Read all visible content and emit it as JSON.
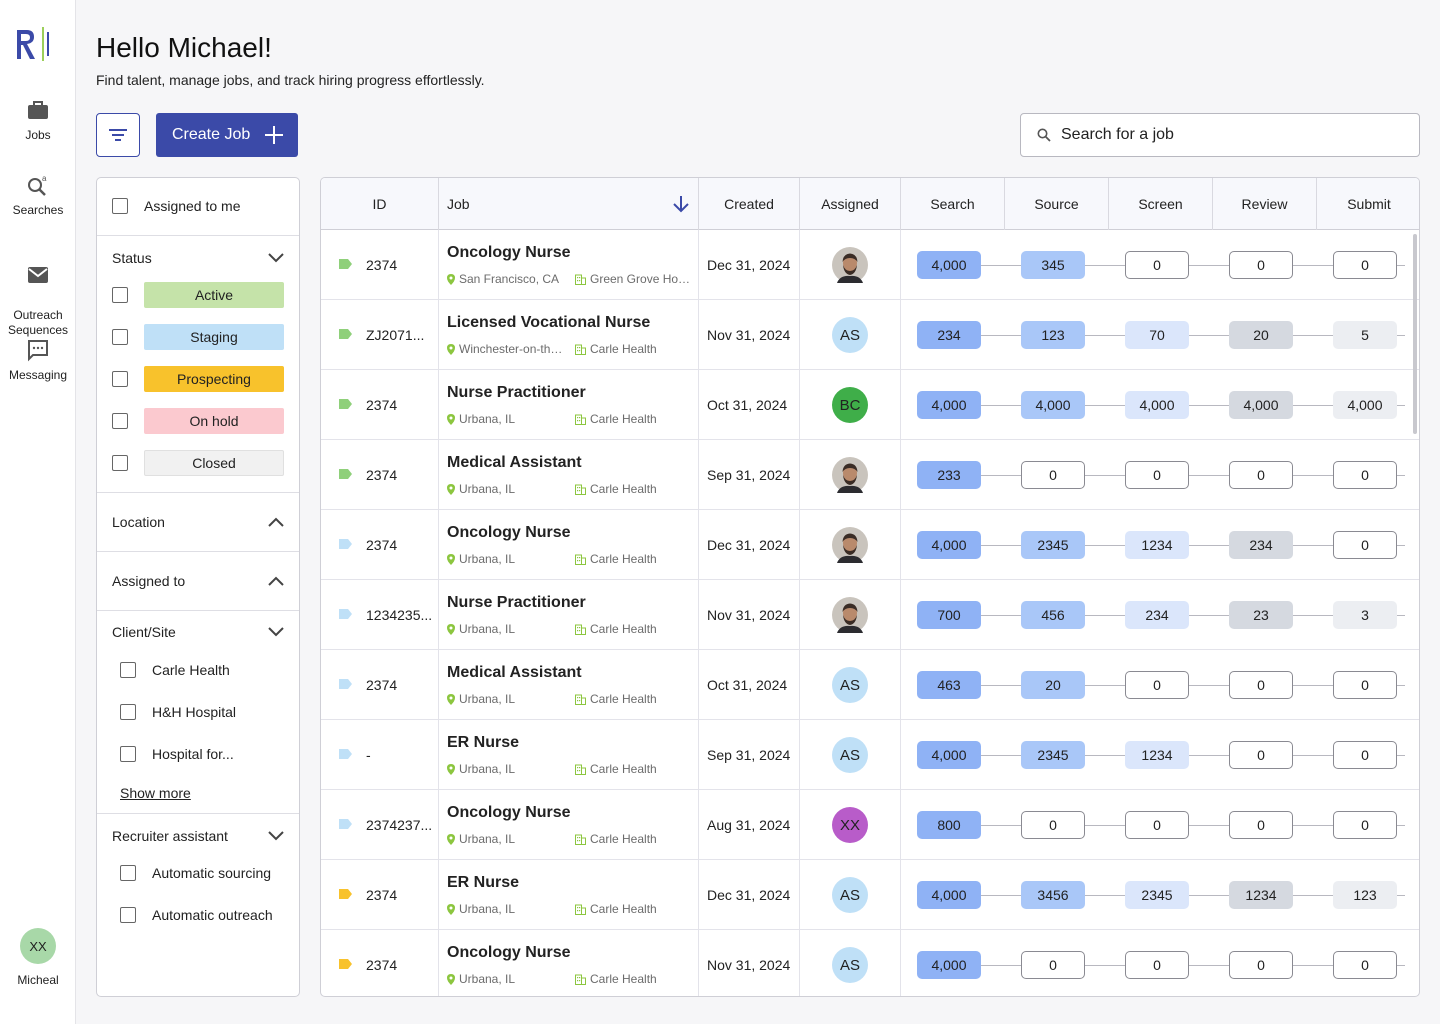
{
  "nav": {
    "items": [
      {
        "label": "Jobs",
        "icon": "briefcase-icon"
      },
      {
        "label": "Searches",
        "icon": "search-sparkle-icon"
      },
      {
        "label": "Outreach\nSequences",
        "icon": "mail-icon"
      },
      {
        "label": "Messaging",
        "icon": "chat-icon"
      }
    ],
    "user": {
      "initials": "XX",
      "name": "Micheal"
    }
  },
  "header": {
    "greeting": "Hello Michael!",
    "subtitle": "Find talent, manage jobs, and track hiring progress effortlessly.",
    "create_label": "Create Job",
    "search_placeholder": "Search for a job"
  },
  "filters": {
    "assigned_to_me": "Assigned to me",
    "status": {
      "title": "Status",
      "options": [
        {
          "label": "Active",
          "color": "#c5e3a9"
        },
        {
          "label": "Staging",
          "color": "#bfe0f7"
        },
        {
          "label": "Prospecting",
          "color": "#f8c22c"
        },
        {
          "label": "On hold",
          "color": "#fbc9cf"
        },
        {
          "label": "Closed",
          "color": "#f1f1f1"
        }
      ]
    },
    "location": {
      "title": "Location"
    },
    "assigned_to": {
      "title": "Assigned to"
    },
    "client_site": {
      "title": "Client/Site",
      "options": [
        "Carle Health",
        "H&H Hospital",
        "Hospital for..."
      ],
      "show_more": "Show more"
    },
    "recruiter_assistant": {
      "title": "Recruiter assistant",
      "options": [
        "Automatic sourcing",
        "Automatic outreach"
      ]
    }
  },
  "table": {
    "columns": [
      "ID",
      "Job",
      "Created",
      "Assigned",
      "Search",
      "Source",
      "Screen",
      "Review",
      "Submit"
    ],
    "rows": [
      {
        "id": "2374",
        "tag": "#8fd07a",
        "title": "Oncology Nurse",
        "location": "San Francisco, CA",
        "client": "Green Grove Hos...",
        "created": "Dec 31, 2024",
        "assigned": {
          "type": "photo"
        },
        "pipeline": [
          "4,000",
          "345",
          "0",
          "0",
          "0"
        ]
      },
      {
        "id": "ZJ2071...",
        "tag": "#8fd07a",
        "title": "Licensed Vocational Nurse",
        "location": "Winchester-on-the-...",
        "client": "Carle Health",
        "created": "Nov 31, 2024",
        "assigned": {
          "type": "initials",
          "text": "AS",
          "color": "#bfe0f7"
        },
        "pipeline": [
          "234",
          "123",
          "70",
          "20",
          "5"
        ]
      },
      {
        "id": "2374",
        "tag": "#8fd07a",
        "title": "Nurse Practitioner",
        "location": "Urbana, IL",
        "client": "Carle Health",
        "created": "Oct 31, 2024",
        "assigned": {
          "type": "initials",
          "text": "BC",
          "color": "#3fae49"
        },
        "pipeline": [
          "4,000",
          "4,000",
          "4,000",
          "4,000",
          "4,000"
        ]
      },
      {
        "id": "2374",
        "tag": "#8fd07a",
        "title": "Medical Assistant",
        "location": "Urbana, IL",
        "client": "Carle Health",
        "created": "Sep 31, 2024",
        "assigned": {
          "type": "photo"
        },
        "pipeline": [
          "233",
          "0",
          "0",
          "0",
          "0"
        ]
      },
      {
        "id": "2374",
        "tag": "#bfe0f7",
        "title": "Oncology Nurse",
        "location": "Urbana, IL",
        "client": "Carle Health",
        "created": "Dec 31, 2024",
        "assigned": {
          "type": "photo"
        },
        "pipeline": [
          "4,000",
          "2345",
          "1234",
          "234",
          "0"
        ]
      },
      {
        "id": "1234235...",
        "tag": "#bfe0f7",
        "title": "Nurse Practitioner",
        "location": "Urbana, IL",
        "client": "Carle Health",
        "created": "Nov 31, 2024",
        "assigned": {
          "type": "photo"
        },
        "pipeline": [
          "700",
          "456",
          "234",
          "23",
          "3"
        ]
      },
      {
        "id": "2374",
        "tag": "#bfe0f7",
        "title": "Medical Assistant",
        "location": "Urbana, IL",
        "client": "Carle Health",
        "created": "Oct 31, 2024",
        "assigned": {
          "type": "initials",
          "text": "AS",
          "color": "#bfe0f7"
        },
        "pipeline": [
          "463",
          "20",
          "0",
          "0",
          "0"
        ]
      },
      {
        "id": "-",
        "tag": "#bfe0f7",
        "title": "ER Nurse",
        "location": "Urbana, IL",
        "client": "Carle Health",
        "created": "Sep 31, 2024",
        "assigned": {
          "type": "initials",
          "text": "AS",
          "color": "#bfe0f7"
        },
        "pipeline": [
          "4,000",
          "2345",
          "1234",
          "0",
          "0"
        ]
      },
      {
        "id": "2374237...",
        "tag": "#bfe0f7",
        "title": "Oncology Nurse",
        "location": "Urbana, IL",
        "client": "Carle Health",
        "created": "Aug 31, 2024",
        "assigned": {
          "type": "initials",
          "text": "XX",
          "color": "#b85cc9"
        },
        "pipeline": [
          "800",
          "0",
          "0",
          "0",
          "0"
        ]
      },
      {
        "id": "2374",
        "tag": "#f8c22c",
        "title": "ER Nurse",
        "location": "Urbana, IL",
        "client": "Carle Health",
        "created": "Dec 31, 2024",
        "assigned": {
          "type": "initials",
          "text": "AS",
          "color": "#bfe0f7"
        },
        "pipeline": [
          "4,000",
          "3456",
          "2345",
          "1234",
          "123"
        ]
      },
      {
        "id": "2374",
        "tag": "#f8c22c",
        "title": "Oncology Nurse",
        "location": "Urbana, IL",
        "client": "Carle Health",
        "created": "Nov 31, 2024",
        "assigned": {
          "type": "initials",
          "text": "AS",
          "color": "#bfe0f7"
        },
        "pipeline": [
          "4,000",
          "0",
          "0",
          "0",
          "0"
        ]
      }
    ]
  },
  "colors": {
    "primary": "#3b4aa8",
    "search_pill": "#8fb2f5",
    "source_pill": "#a9c7f8",
    "screen_pill": "#dbe6fb",
    "review_pill": "#d5d9e0",
    "submit_pill": "#eceef2"
  }
}
